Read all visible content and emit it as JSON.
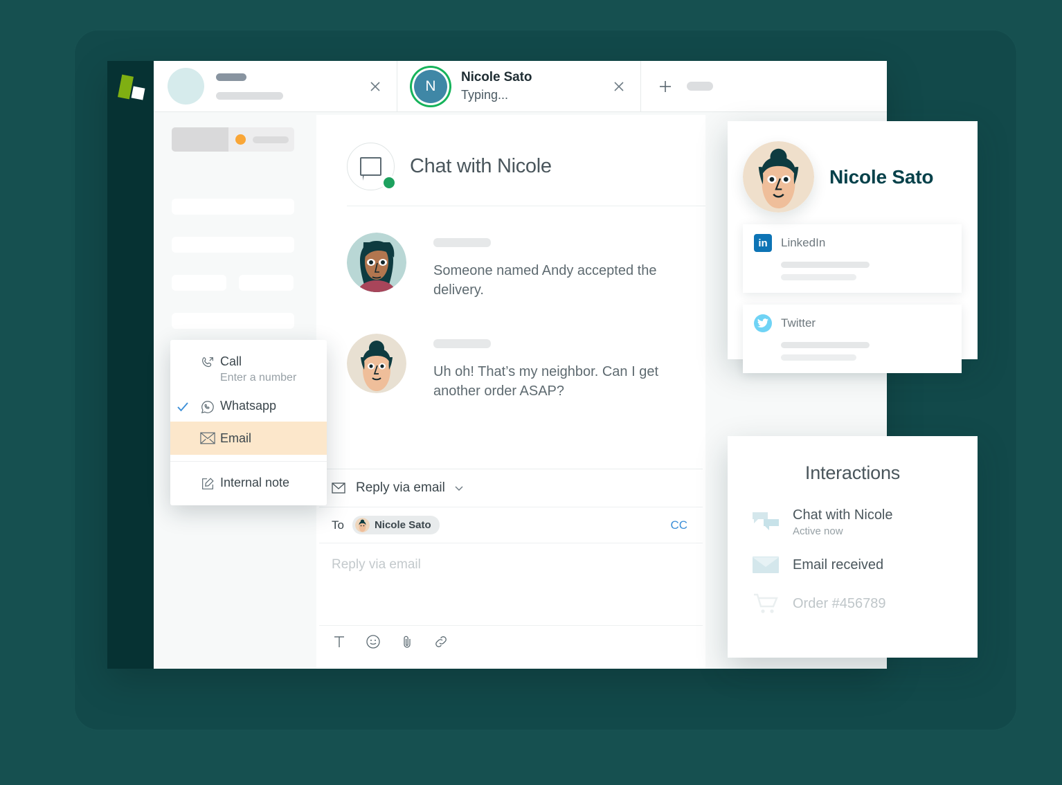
{
  "brand": {
    "logo_name": "logo-mark",
    "accent_green": "#7FAF12",
    "background": "#165050",
    "rail": "#063233"
  },
  "tabs": [
    {
      "name": "placeholder-tab",
      "title": "",
      "subtitle": "",
      "close_label": "×",
      "avatar": "blank-avatar"
    },
    {
      "name": "nicole-tab",
      "title": "Nicole Sato",
      "subtitle": "Typing...",
      "avatar_initial": "N",
      "close_label": "×",
      "status_color": "#16B35B"
    }
  ],
  "new_tab": {
    "plus_label": "+"
  },
  "list_pane": {
    "filter_dot_color": "#F9A637"
  },
  "chat": {
    "title": "Chat with Nicole",
    "status": "online",
    "status_color": "#1DA15E",
    "icon": "chat-bubble-icon",
    "messages": [
      {
        "author_avatar": "woman-dark-hair-avatar",
        "text": "Someone named Andy accepted the delivery."
      },
      {
        "author_avatar": "nicole-avatar",
        "text": "Uh oh! That’s my neighbor. Can I get another order ASAP?"
      }
    ]
  },
  "composer": {
    "channel_label": "Reply via email",
    "channel_icon": "envelope-icon",
    "chevron_icon": "chevron-down-icon",
    "to_label": "To",
    "to_recipient": "Nicole Sato",
    "cc_label": "CC",
    "placeholder": "Reply via email",
    "toolbar": [
      {
        "name": "text-format-icon",
        "glyph": "T"
      },
      {
        "name": "emoji-icon",
        "glyph": "☺"
      },
      {
        "name": "attachment-icon",
        "glyph": "📎"
      },
      {
        "name": "link-icon",
        "glyph": "🔗"
      }
    ]
  },
  "channel_menu": {
    "highlight_color": "#FCE7CB",
    "check_color": "#3C8FD8",
    "items": [
      {
        "name": "menu-item-call",
        "label": "Call",
        "sub": "Enter a number",
        "icon": "phone-icon",
        "checked": false,
        "highlighted": false
      },
      {
        "name": "menu-item-whatsapp",
        "label": "Whatsapp",
        "sub": "",
        "icon": "whatsapp-icon",
        "checked": true,
        "highlighted": false
      },
      {
        "name": "menu-item-email",
        "label": "Email",
        "sub": "",
        "icon": "envelope-icon",
        "checked": false,
        "highlighted": true
      },
      {
        "name": "menu-item-internal-note",
        "label": "Internal note",
        "sub": "",
        "icon": "note-edit-icon",
        "checked": false,
        "highlighted": false
      }
    ]
  },
  "contact_card": {
    "name": "Nicole Sato",
    "avatar": "nicole-portrait",
    "socials": [
      {
        "name": "LinkedIn",
        "icon": "linkedin-icon",
        "color": "#0D74B5",
        "glyph": "in"
      },
      {
        "name": "Twitter",
        "icon": "twitter-icon",
        "color": "#6FD3F5",
        "glyph": "t"
      }
    ]
  },
  "interactions": {
    "title": "Interactions",
    "items": [
      {
        "name": "interaction-chat",
        "label": "Chat with Nicole",
        "sub": "Active now",
        "icon": "chat-bubbles-icon",
        "muted": false
      },
      {
        "name": "interaction-email",
        "label": "Email received",
        "sub": "",
        "icon": "envelope-icon",
        "muted": false
      },
      {
        "name": "interaction-order",
        "label": "Order #456789",
        "sub": "",
        "icon": "shopping-cart-icon",
        "muted": true
      }
    ]
  }
}
